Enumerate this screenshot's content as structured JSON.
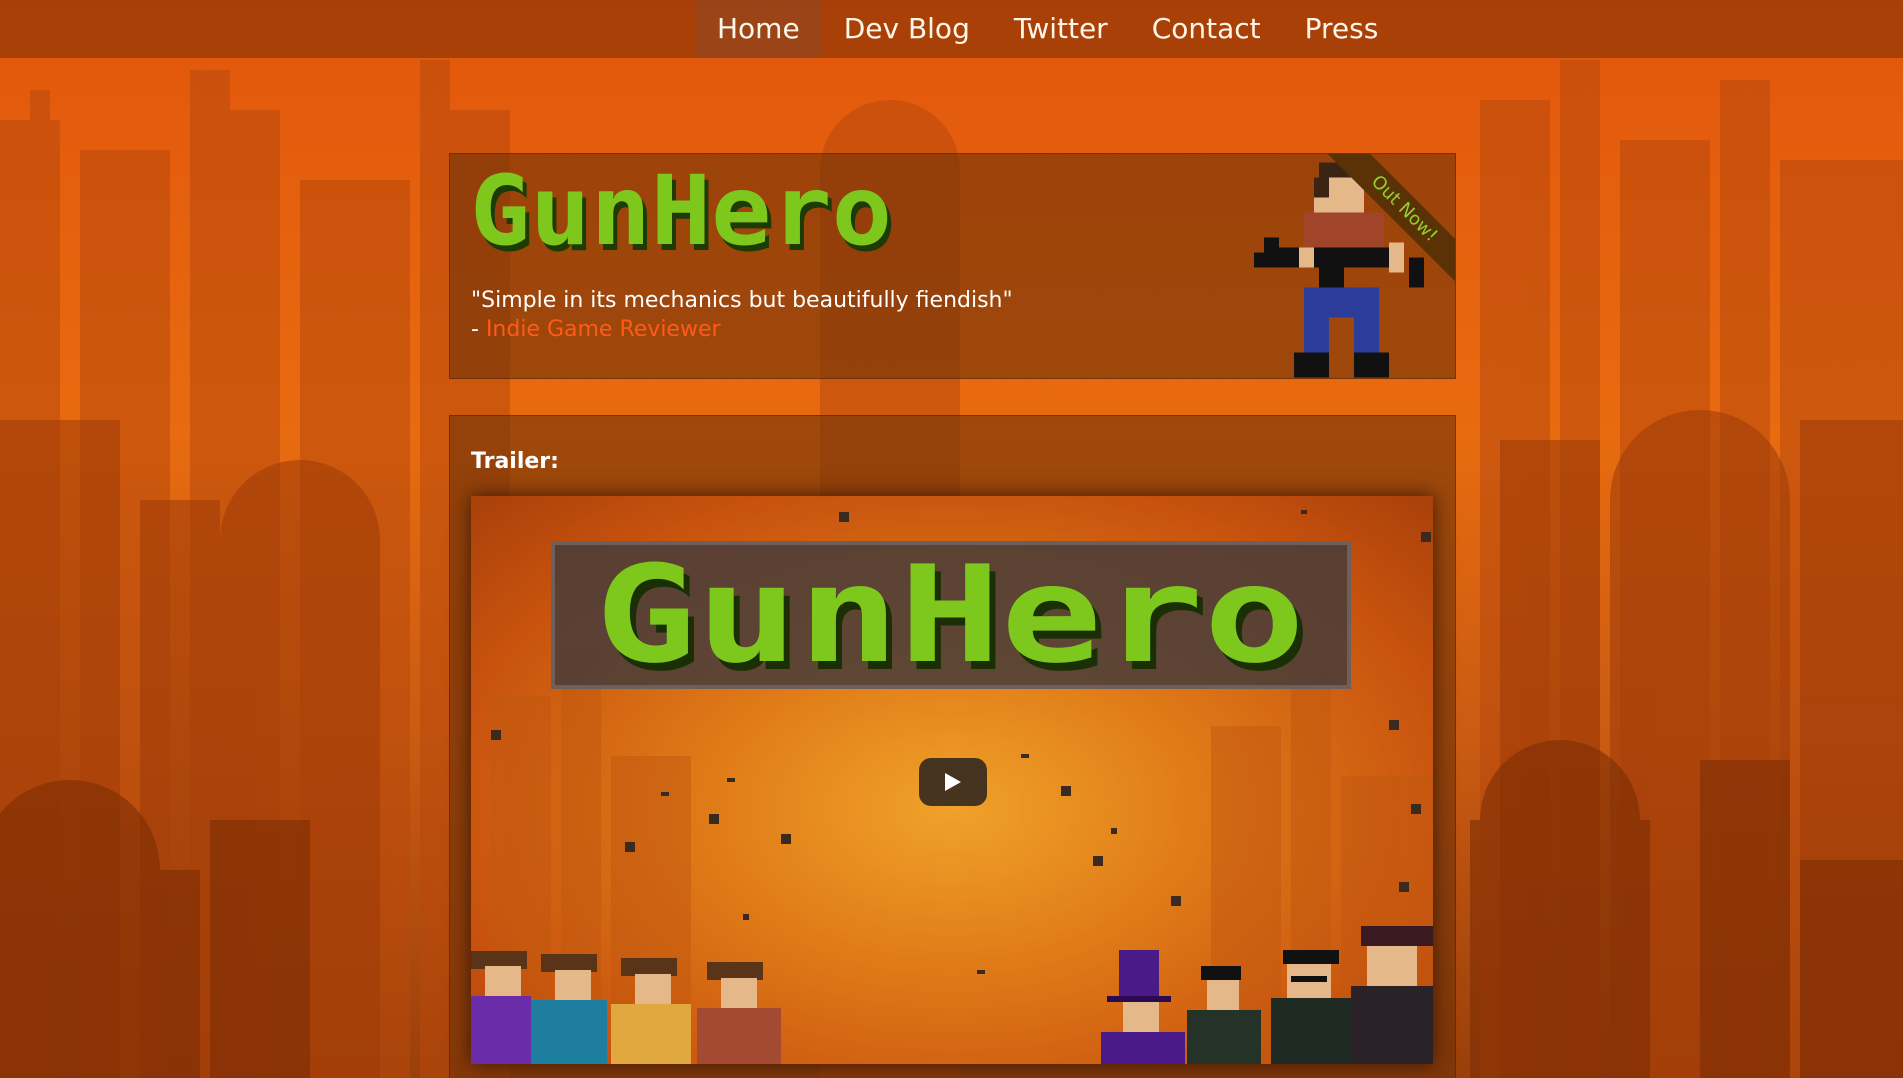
{
  "nav": {
    "items": [
      {
        "label": "Home",
        "active": true
      },
      {
        "label": "Dev Blog",
        "active": false
      },
      {
        "label": "Twitter",
        "active": false
      },
      {
        "label": "Contact",
        "active": false
      },
      {
        "label": "Press",
        "active": false
      }
    ]
  },
  "header": {
    "logo_text": "GunHero",
    "quote": "\"Simple in its mechanics but beautifully fiendish\"",
    "attribution_prefix": "- ",
    "attribution_link": "Indie Game Reviewer",
    "ribbon": "Out Now!"
  },
  "trailer": {
    "label": "Trailer:",
    "video_logo_text": "GunHero",
    "play_icon": "play-icon"
  },
  "colors": {
    "accent_link": "#ff5a1a",
    "logo_green": "#7ec71c",
    "ribbon_text": "#8fd22c"
  }
}
